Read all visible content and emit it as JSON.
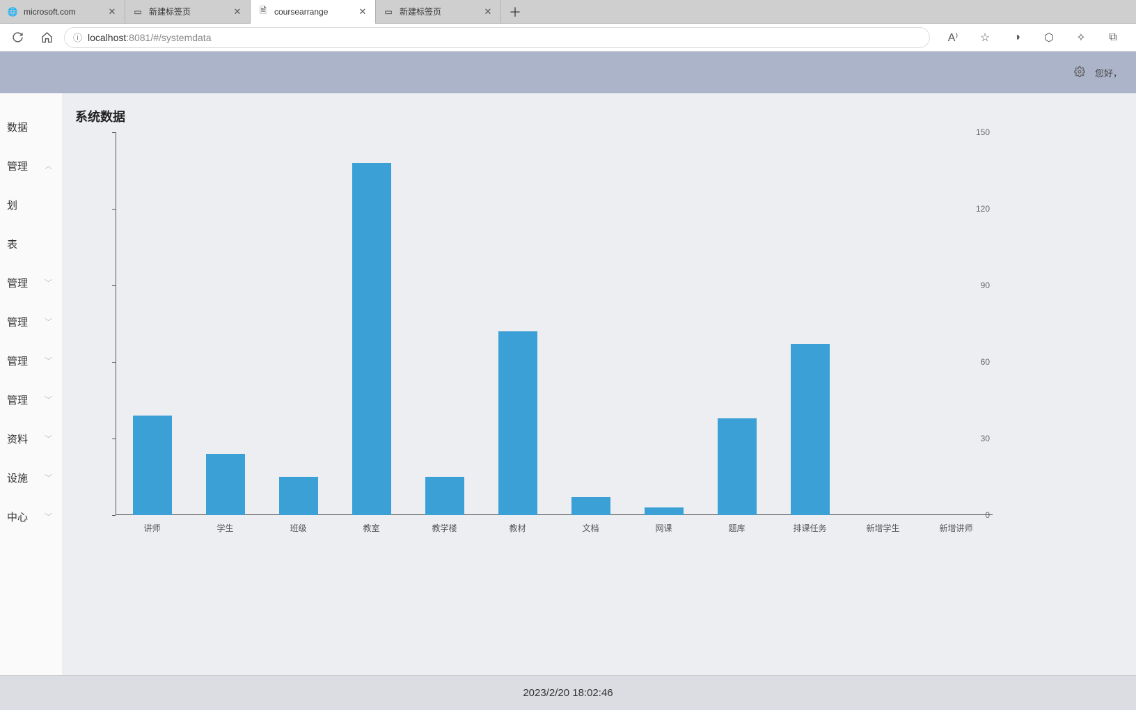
{
  "tabs": [
    {
      "title": "microsoft.com",
      "icon": "globe"
    },
    {
      "title": "新建标签页",
      "icon": "edge"
    },
    {
      "title": "coursearrange",
      "icon": "doc",
      "active": true
    },
    {
      "title": "新建标签页",
      "icon": "edge"
    }
  ],
  "url": {
    "host": "localhost",
    "port": ":8081",
    "path": "/#/systemdata"
  },
  "header": {
    "greeting": "您好，"
  },
  "sidebar": {
    "items": [
      {
        "label": "数据",
        "expandable": false
      },
      {
        "label": "管理",
        "expandable": true,
        "expanded": true
      },
      {
        "label": "划",
        "expandable": false
      },
      {
        "label": "表",
        "expandable": false
      },
      {
        "label": "管理",
        "expandable": true
      },
      {
        "label": "管理",
        "expandable": true
      },
      {
        "label": "管理",
        "expandable": true
      },
      {
        "label": "管理",
        "expandable": true
      },
      {
        "label": "资料",
        "expandable": true
      },
      {
        "label": "设施",
        "expandable": true
      },
      {
        "label": "中心",
        "expandable": true
      }
    ]
  },
  "page": {
    "title": "系统数据"
  },
  "footer": {
    "timestamp": "2023/2/20 18:02:46"
  },
  "chart_data": {
    "type": "bar",
    "title": "",
    "xlabel": "",
    "ylabel": "",
    "ylim": [
      0,
      150
    ],
    "yticks": [
      0,
      30,
      60,
      90,
      120,
      150
    ],
    "categories": [
      "讲师",
      "学生",
      "班级",
      "教室",
      "教学楼",
      "教材",
      "文档",
      "网课",
      "题库",
      "排课任务",
      "新增学生",
      "新增讲师"
    ],
    "values": [
      39,
      24,
      15,
      138,
      15,
      72,
      7,
      3,
      38,
      67,
      0,
      0
    ],
    "bar_color": "#3aa0d6"
  }
}
